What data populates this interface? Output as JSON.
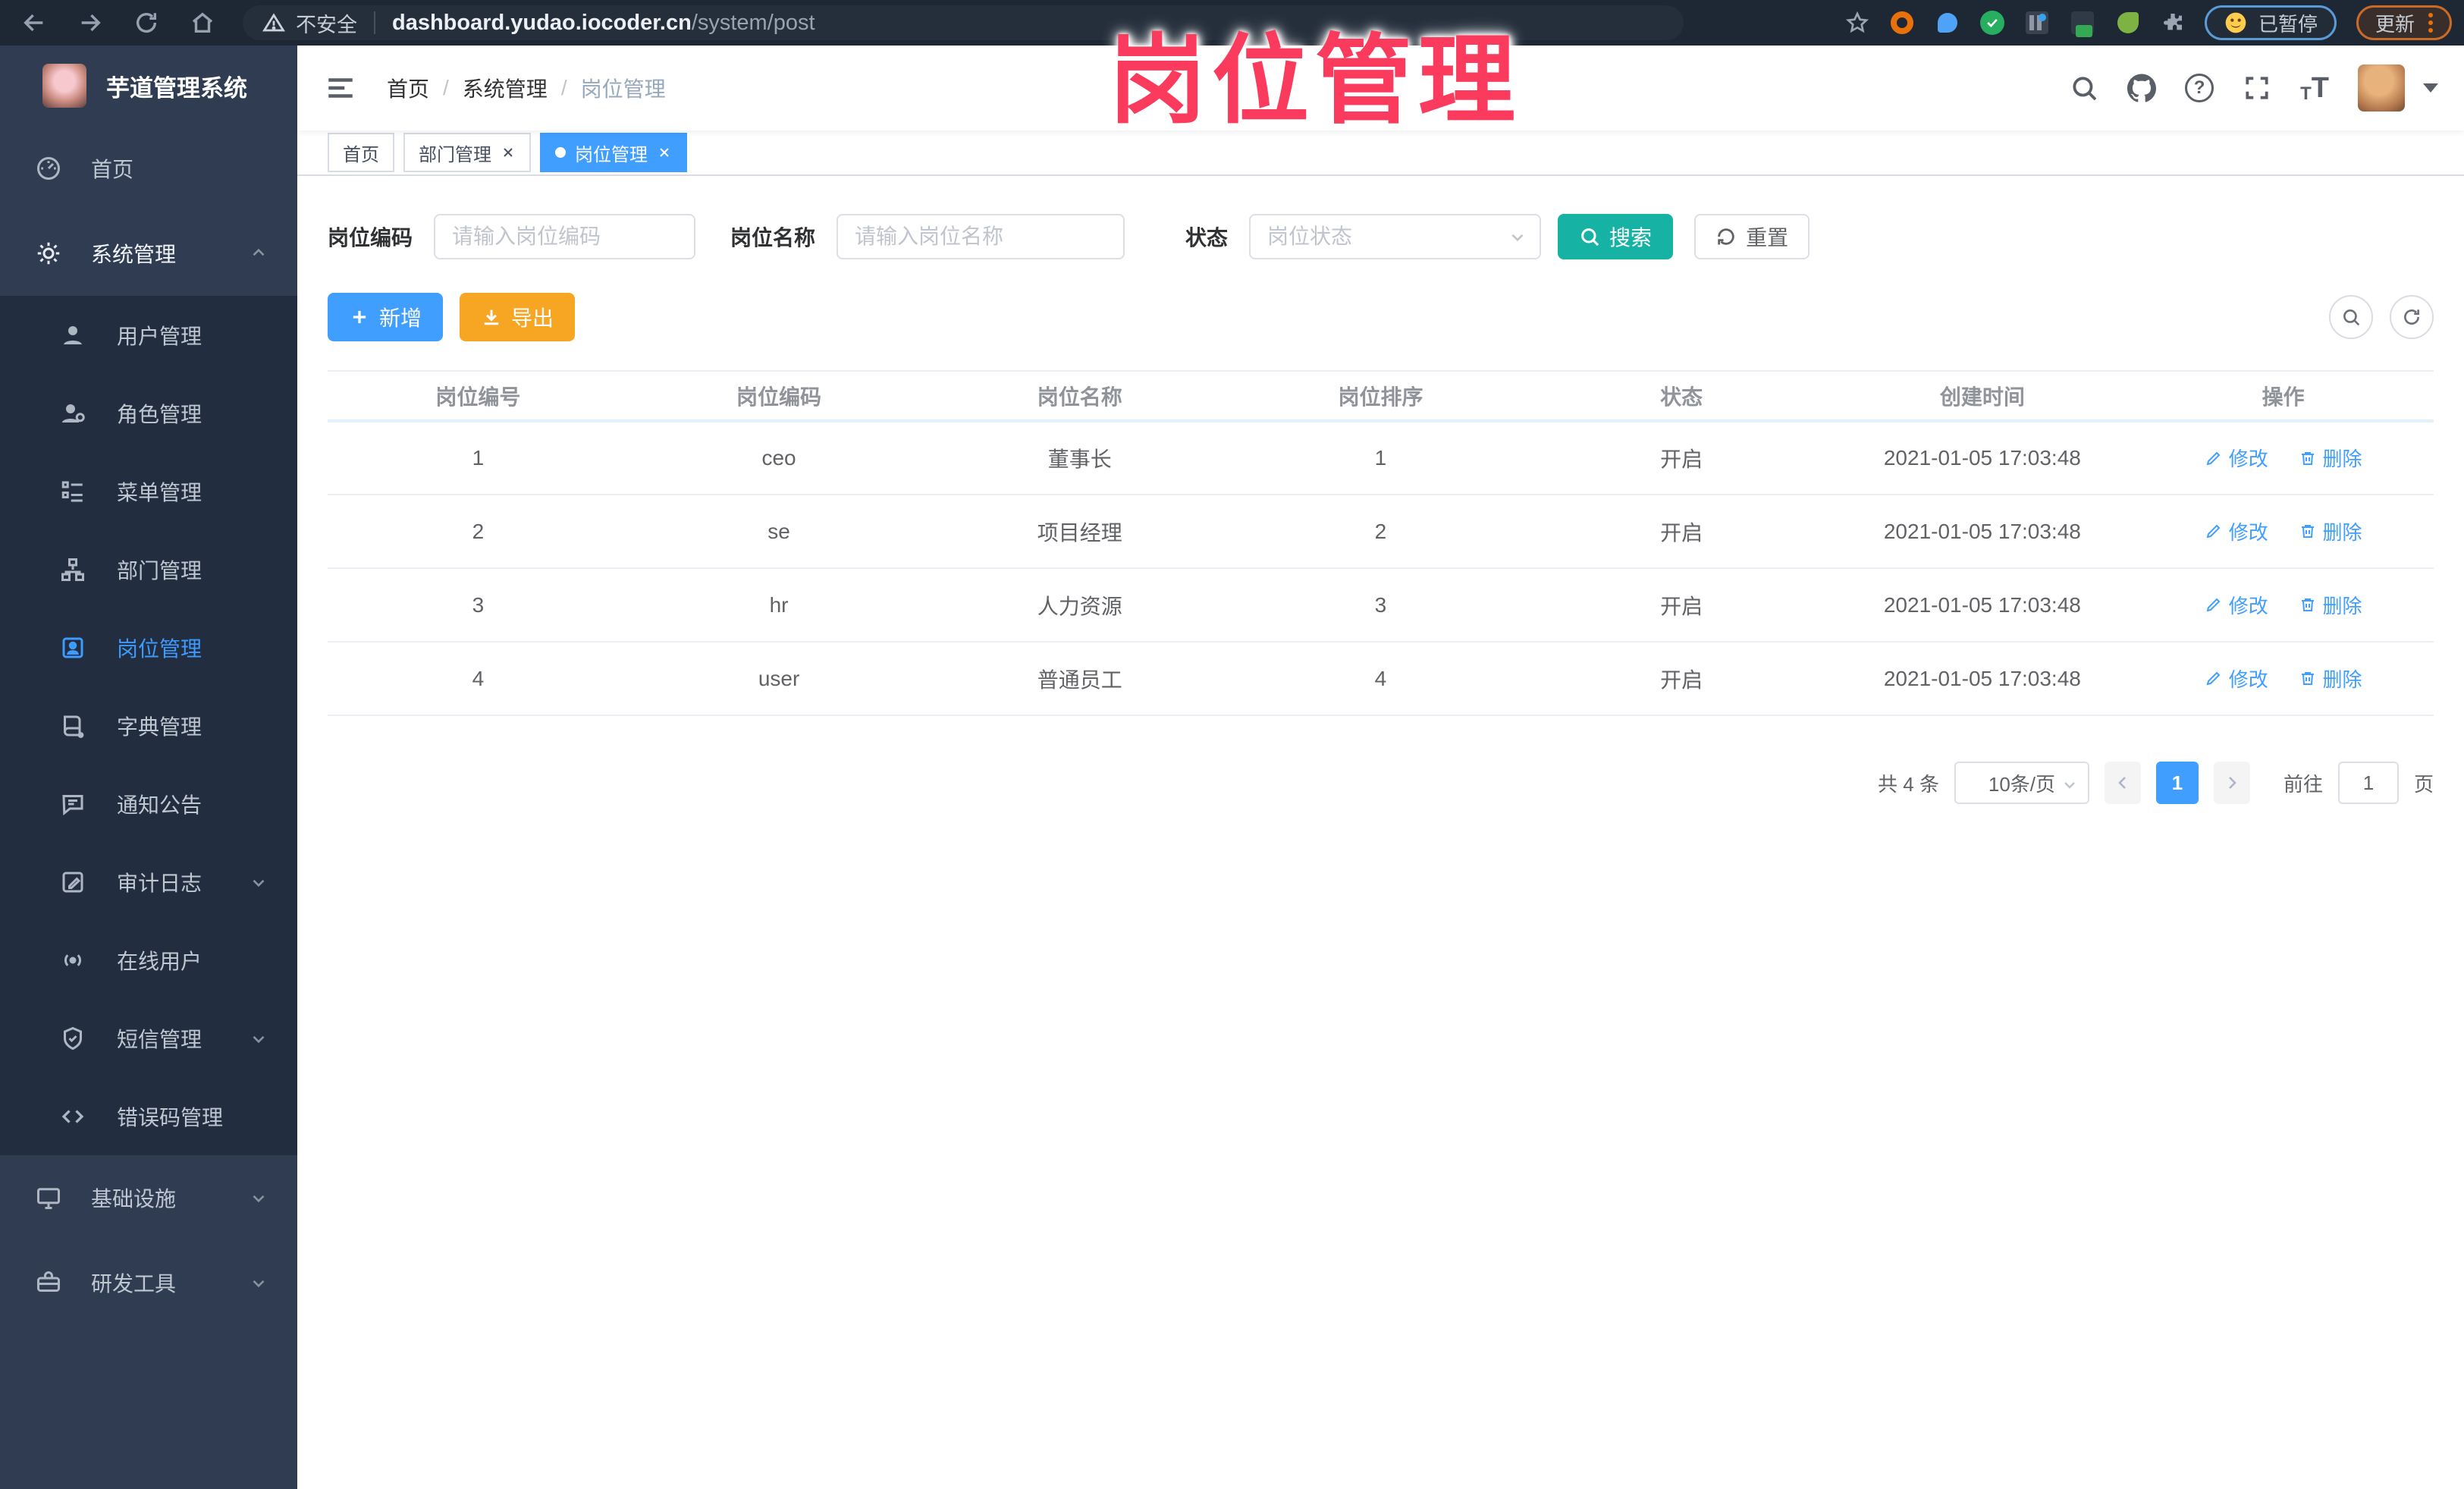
{
  "browser": {
    "security_label": "不安全",
    "url_host": "dashboard.yudao.iocoder.cn",
    "url_path": "/system/post",
    "paused_label": "已暂停",
    "update_label": "更新"
  },
  "watermark": "岗位管理",
  "sidebar": {
    "title": "芋道管理系统",
    "items": [
      {
        "label": "首页"
      },
      {
        "label": "系统管理"
      },
      {
        "label": "用户管理"
      },
      {
        "label": "角色管理"
      },
      {
        "label": "菜单管理"
      },
      {
        "label": "部门管理"
      },
      {
        "label": "岗位管理"
      },
      {
        "label": "字典管理"
      },
      {
        "label": "通知公告"
      },
      {
        "label": "审计日志"
      },
      {
        "label": "在线用户"
      },
      {
        "label": "短信管理"
      },
      {
        "label": "错误码管理"
      },
      {
        "label": "基础设施"
      },
      {
        "label": "研发工具"
      }
    ]
  },
  "breadcrumb": {
    "items": [
      "首页",
      "系统管理",
      "岗位管理"
    ],
    "separator": "/"
  },
  "tabs": [
    {
      "label": "首页"
    },
    {
      "label": "部门管理"
    },
    {
      "label": "岗位管理"
    }
  ],
  "icons": {
    "help_glyph": "?",
    "fontsize_glyph": "T"
  },
  "filters": {
    "post_code_label": "岗位编码",
    "post_code_placeholder": "请输入岗位编码",
    "post_name_label": "岗位名称",
    "post_name_placeholder": "请输入岗位名称",
    "status_label": "状态",
    "status_placeholder": "岗位状态",
    "search_label": "搜索",
    "reset_label": "重置"
  },
  "toolbar": {
    "add_label": "新增",
    "export_label": "导出"
  },
  "table": {
    "headers": [
      "岗位编号",
      "岗位编码",
      "岗位名称",
      "岗位排序",
      "状态",
      "创建时间",
      "操作"
    ],
    "edit_label": "修改",
    "delete_label": "删除",
    "rows": [
      {
        "id": "1",
        "code": "ceo",
        "name": "董事长",
        "sort": "1",
        "status": "开启",
        "created": "2021-01-05 17:03:48"
      },
      {
        "id": "2",
        "code": "se",
        "name": "项目经理",
        "sort": "2",
        "status": "开启",
        "created": "2021-01-05 17:03:48"
      },
      {
        "id": "3",
        "code": "hr",
        "name": "人力资源",
        "sort": "3",
        "status": "开启",
        "created": "2021-01-05 17:03:48"
      },
      {
        "id": "4",
        "code": "user",
        "name": "普通员工",
        "sort": "4",
        "status": "开启",
        "created": "2021-01-05 17:03:48"
      }
    ]
  },
  "pagination": {
    "total_text": "共 4 条",
    "page_size": "10条/页",
    "current_page": "1",
    "goto_prefix": "前往",
    "goto_value": "1",
    "goto_suffix": "页"
  },
  "colors": {
    "accent_blue": "#409EFF",
    "search_teal": "#16B3A4",
    "export_orange": "#F6A623",
    "sidebar_bg": "#2F3C52",
    "submenu_bg": "#222D3F",
    "chrome_bg": "#1E2734",
    "watermark_pink": "#FB3B5D"
  }
}
